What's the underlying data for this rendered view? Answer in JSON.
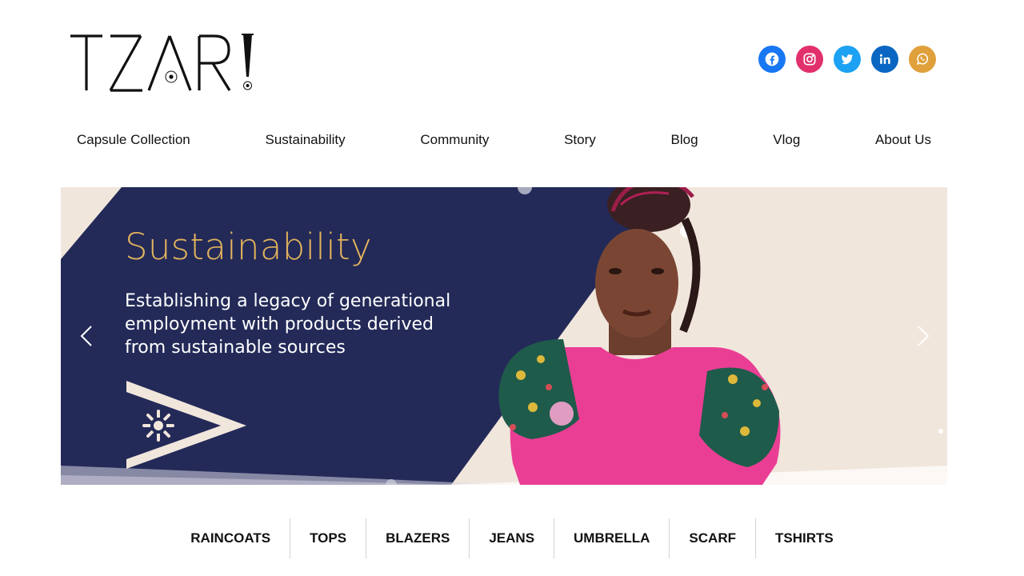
{
  "brand": {
    "logo_text": "TZARI"
  },
  "social": [
    {
      "name": "facebook",
      "color": "#1877f2"
    },
    {
      "name": "instagram",
      "color": "#e1306c"
    },
    {
      "name": "twitter",
      "color": "#1da1f2"
    },
    {
      "name": "linkedin",
      "color": "#0a66c2"
    },
    {
      "name": "whatsapp",
      "color": "#e0a03b"
    }
  ],
  "nav": {
    "items": [
      "Capsule Collection",
      "Sustainability",
      "Community",
      "Story",
      "Blog",
      "Vlog",
      "About Us"
    ]
  },
  "hero": {
    "title": "Sustainability",
    "subtitle": "Establishing a legacy of generational employment with products derived from sustainable sources",
    "colors": {
      "navy": "#232a58",
      "gold": "#e3b35c",
      "cream": "#f1e6dc",
      "pink": "#ec3f95"
    }
  },
  "categories": [
    "RAINCOATS",
    "TOPS",
    "BLAZERS",
    "JEANS",
    "UMBRELLA",
    "SCARF",
    "TSHIRTS"
  ]
}
